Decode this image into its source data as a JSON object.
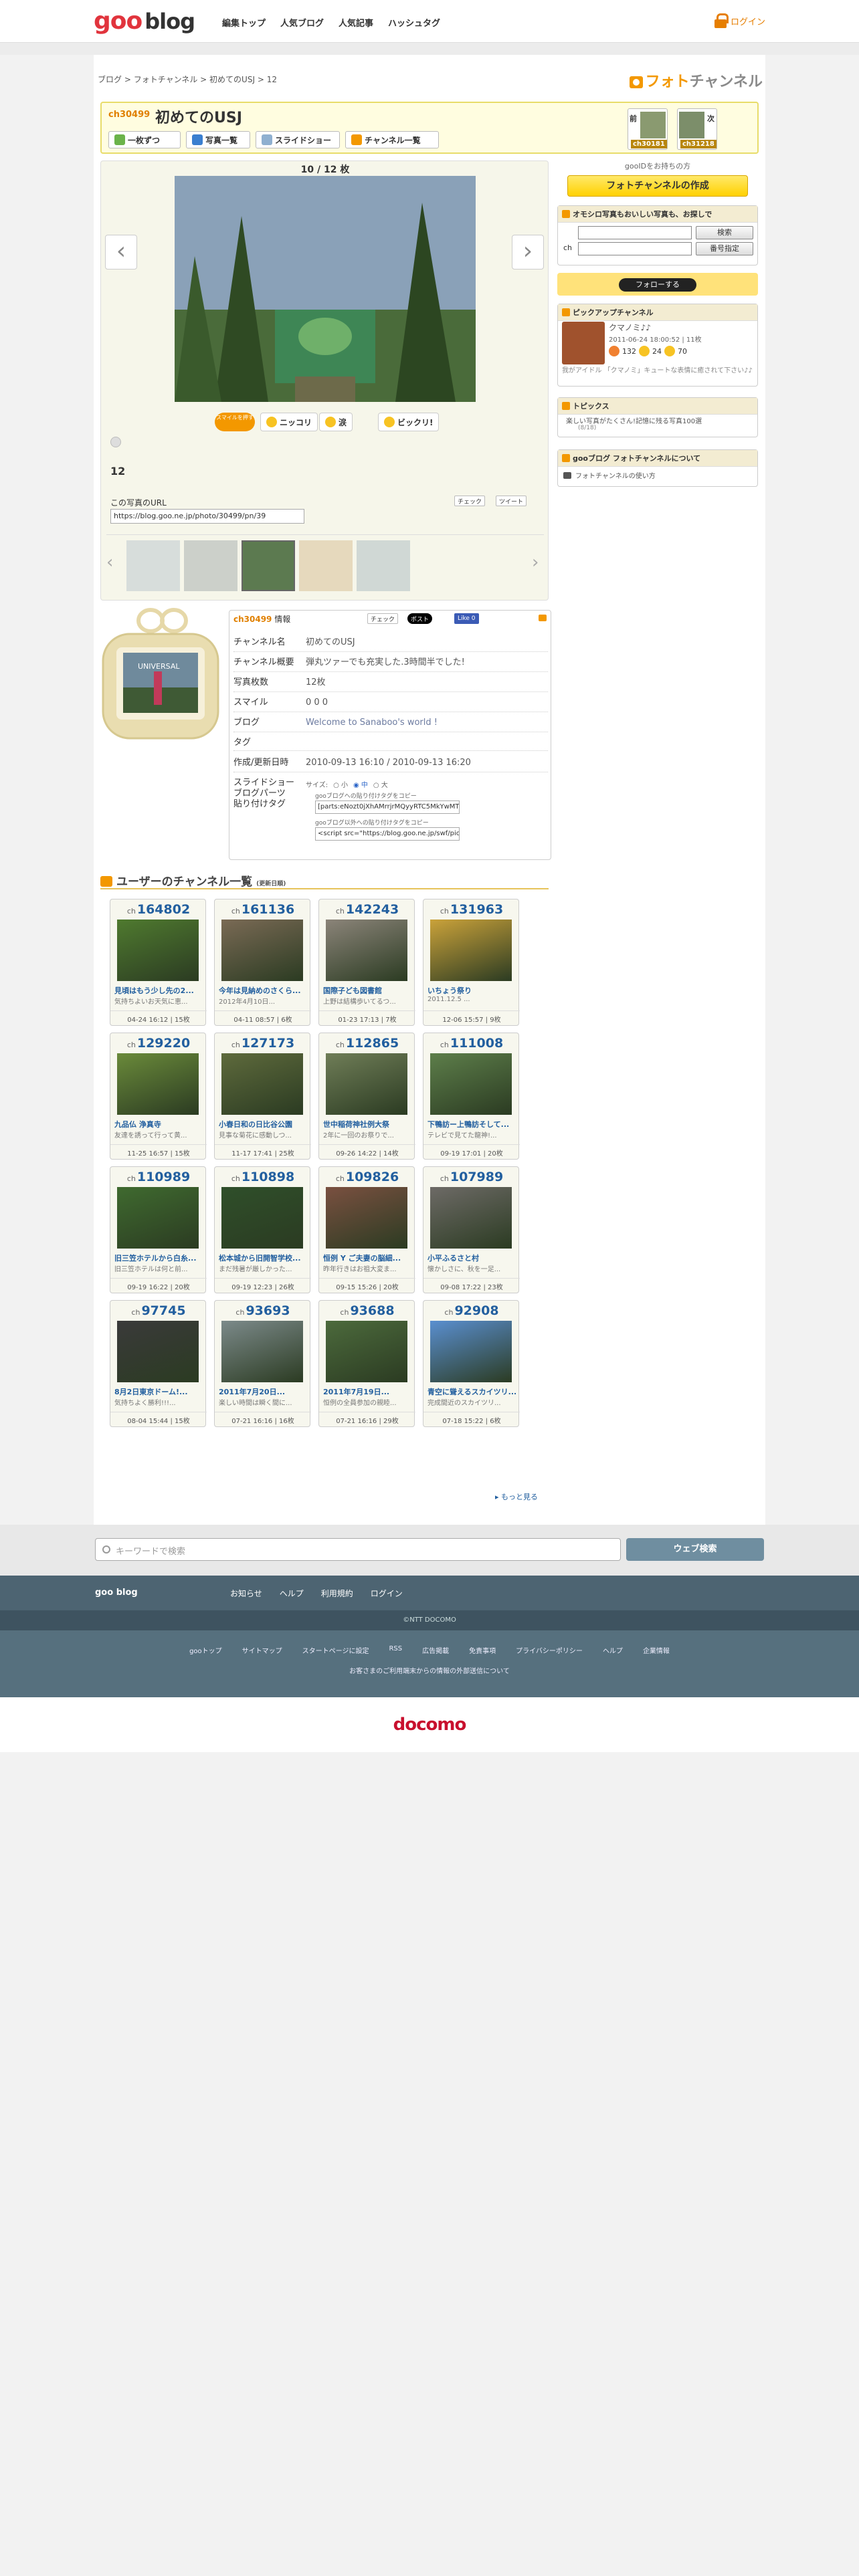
{
  "header": {
    "logo_goo": "goo",
    "logo_blog": "blog",
    "nav": [
      "編集トップ",
      "人気ブログ",
      "人気記事",
      "ハッシュタグ"
    ],
    "login": "ログイン"
  },
  "breadcrumb": [
    "ブログ",
    "フォトチャンネル",
    "初めてのUSJ",
    "12"
  ],
  "page_title": {
    "main": "フォト",
    "sub": "チャンネル"
  },
  "channel": {
    "number": "ch30499",
    "name": "初めてのUSJ",
    "toolbar": [
      "一枚ずつ",
      "写真一覧",
      "スライドショー",
      "チャンネル一覧"
    ],
    "prev_label": "前",
    "prev_no": "ch30181",
    "next_label": "次",
    "next_no": "ch31218"
  },
  "viewer": {
    "count": "10 / 12 枚",
    "badge": "スマイルを押す",
    "emotions": [
      "ニッコリ",
      "涙",
      "ビックリ!"
    ],
    "photo_number": "12",
    "url_label": "この写真のURL",
    "url_value": "https://blog.goo.ne.jp/photo/30499/pn/39",
    "check": "チェック",
    "tweet": "ツイート"
  },
  "sidebar": {
    "gooid_text": "gooIDをお持ちの方",
    "create_button": "フォトチャンネルの作成",
    "search_title": "オモシロ写真もおいしい写真も、お探しで",
    "search_button": "検索",
    "ch_label": "ch",
    "number_button": "番号指定",
    "follow_button": "フォローする",
    "pickup_title": "ピックアップチャンネル",
    "pickup_name": "クマノミ♪♪",
    "pickup_meta": "2011-06-24 18:00:52 | 11枚",
    "pickup_counts": [
      "132",
      "24",
      "70"
    ],
    "pickup_desc": "我がアイドル 「クマノミ」キュートな表情に癒されて下さい♪♪",
    "topics_title": "トピックス",
    "topics_text": "楽しい写真がたくさん!記憶に残る写真100選",
    "topics_date": "(8/18)",
    "about_title": "gooブログ フォトチャンネルについて",
    "about_link": "フォトチャンネルの使い方"
  },
  "info": {
    "number": "ch30499",
    "heading": "情報",
    "check": "チェック",
    "post": "ポスト",
    "like": "Like 0",
    "tv_label": "UNIVERSAL",
    "rows": [
      {
        "k": "チャンネル名",
        "v": "初めてのUSJ"
      },
      {
        "k": "チャンネル概要",
        "v": "弾丸ツァーでも充実した.3時間半でした!"
      },
      {
        "k": "写真枚数",
        "v": "12枚"
      },
      {
        "k": "スマイル",
        "v": "0  0  0"
      },
      {
        "k": "ブログ",
        "v": "Welcome to Sanaboo's world !"
      },
      {
        "k": "タグ",
        "v": ""
      },
      {
        "k": "作成/更新日時",
        "v": "2010-09-13 16:10 / 2010-09-13 16:20"
      }
    ],
    "slideshow_label": "スライドショー",
    "blogparts_label": "ブログパーツ",
    "tag_label": "貼り付けタグ",
    "size_label": "サイズ:",
    "sizes": [
      "小",
      "中",
      "大"
    ],
    "copy1": "gooブログへの貼り付けタグをコピー",
    "tag1": "[parts:eNozt0jXhAMrrjrMQyyRTC5MkYwMT",
    "copy2": "gooブログ以外への貼り付けタグをコピー",
    "tag2": "<script src=\"https://blog.goo.ne.jp/swf/pic"
  },
  "list": {
    "title": "ユーザーのチャンネル一覧",
    "sub": "(更新日順)",
    "more": "もっと見る",
    "prefix": "ch",
    "cards": [
      {
        "no": "164802",
        "title": "見頃はもう少し先の2...",
        "desc": "気持ちよいお天気に恵...",
        "meta": "04-24 16:12 | 15枚",
        "c": "#4f7a2f"
      },
      {
        "no": "161136",
        "title": "今年は見納めのさくら...",
        "desc": "2012年4月10日...",
        "meta": "04-11 08:57 | 6枚",
        "c": "#7a6a55"
      },
      {
        "no": "142243",
        "title": "国際子ども図書館",
        "desc": "上野は結構歩いてるつ...",
        "meta": "01-23 17:13 | 7枚",
        "c": "#8b8479"
      },
      {
        "no": "131963",
        "title": "いちょう祭り",
        "desc": "2011.12.5  ...",
        "meta": "12-06 15:57 | 9枚",
        "c": "#caa23a"
      },
      {
        "no": "129220",
        "title": "九品仏 浄真寺",
        "desc": "友達を誘って行って黄...",
        "meta": "11-25 16:57 | 15枚",
        "c": "#6a8a3a"
      },
      {
        "no": "127173",
        "title": "小春日和の日比谷公園",
        "desc": "見事な菊花に感動しつ...",
        "meta": "11-17 17:41 | 25枚",
        "c": "#5e6a3c"
      },
      {
        "no": "112865",
        "title": "世中稲荷神社例大祭",
        "desc": "2年に一回のお祭りで...",
        "meta": "09-26 14:22 | 14枚",
        "c": "#6f7d57"
      },
      {
        "no": "111008",
        "title": "下鴨訪ー上鴨訪そして...",
        "desc": "テレビで見てた龍神!...",
        "meta": "09-19 17:01 | 20枚",
        "c": "#5d7e4a"
      },
      {
        "no": "110989",
        "title": "旧三笠ホテルから白糸...",
        "desc": "旧三笠ホテルは何と前...",
        "meta": "09-19 16:22 | 20枚",
        "c": "#3f6a2f"
      },
      {
        "no": "110898",
        "title": "松本城から旧開智学校...",
        "desc": "まだ残暑が厳しかった...",
        "meta": "09-19 12:23 | 26枚",
        "c": "#2f4f2a"
      },
      {
        "no": "109826",
        "title": "恒例 Y ご夫妻の脳細...",
        "desc": "昨年行きはお祖大変ま...",
        "meta": "09-15 15:26 | 20枚",
        "c": "#7a5040"
      },
      {
        "no": "107989",
        "title": "小平ふるさと村",
        "desc": "懐かしさに、秋を一足...",
        "meta": "09-08 17:22 | 23枚",
        "c": "#6d6a66"
      },
      {
        "no": "97745",
        "title": "8月2日東京ドーム!...",
        "desc": "気持ちよく勝利!!!...",
        "meta": "08-04 15:44 | 15枚",
        "c": "#3a3a3a"
      },
      {
        "no": "93693",
        "title": "2011年7月20日...",
        "desc": "楽しい時間は瞬く間に...",
        "meta": "07-21 16:16 | 16枚",
        "c": "#7c8a8a"
      },
      {
        "no": "93688",
        "title": "2011年7月19日...",
        "desc": "恒例の全員参加の親睦...",
        "meta": "07-21 16:16 | 29枚",
        "c": "#4c6a3c"
      },
      {
        "no": "92908",
        "title": "青空に聳えるスカイツリ...",
        "desc": "完成間近のスカイツリ...",
        "meta": "07-18 15:22 | 6枚",
        "c": "#5a8fd0"
      }
    ]
  },
  "search": {
    "placeholder": "キーワードで検索",
    "button": "ウェブ検索"
  },
  "footer": {
    "brand": "goo blog",
    "links1": [
      "お知らせ",
      "ヘルプ",
      "利用規約",
      "ログイン"
    ],
    "copyright": "©NTT DOCOMO",
    "links2": [
      "gooトップ",
      "サイトマップ",
      "スタートページに設定",
      "RSS",
      "広告掲載",
      "免責事項",
      "プライバシーポリシー",
      "ヘルプ",
      "企業情報"
    ],
    "note": "お客さまのご利用端末からの情報の外部送信について",
    "docomo": "docomo"
  },
  "colors": {
    "accent": "#f39800",
    "link": "#225f9f",
    "brand": "#e1343d"
  }
}
